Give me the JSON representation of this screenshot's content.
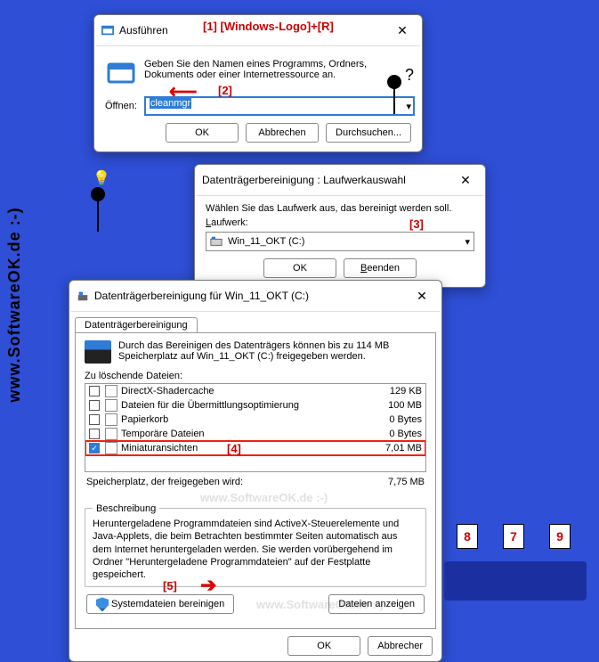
{
  "watermark_vert": "www.SoftwareOK.de :-)",
  "faint_wm": "www.SoftwareOK.de :-)",
  "anno": {
    "a1": "[1] [Windows-Logo]+[R]",
    "a2": "[2]",
    "a3": "[3]",
    "a4": "[4]",
    "a5": "[5]"
  },
  "run": {
    "title": "Ausführen",
    "desc": "Geben Sie den Namen eines Programms, Ordners, Dokuments oder einer Internetressource an.",
    "open_label": "Öffnen:",
    "open_value": "cleanmgr",
    "ok": "OK",
    "cancel": "Abbrechen",
    "browse": "Durchsuchen..."
  },
  "drive": {
    "title": "Datenträgerbereinigung : Laufwerkauswahl",
    "desc": "Wählen Sie das Laufwerk aus, das bereinigt werden soll.",
    "lbl": "Laufwerk:",
    "value": "Win_11_OKT (C:)",
    "ok": "OK",
    "exit": "Beenden"
  },
  "cleanup": {
    "title": "Datenträgerbereinigung für Win_11_OKT (C:)",
    "tab": "Datenträgerbereinigung",
    "summary": "Durch das Bereinigen des Datenträgers können bis zu 114 MB Speicherplatz auf Win_11_OKT (C:) freigegeben werden.",
    "list_label": "Zu löschende Dateien:",
    "rows": [
      {
        "name": "DirectX-Shadercache",
        "size": "129 KB",
        "checked": false
      },
      {
        "name": "Dateien für die Übermittlungsoptimierung",
        "size": "100 MB",
        "checked": false
      },
      {
        "name": "Papierkorb",
        "size": "0 Bytes",
        "checked": false
      },
      {
        "name": "Temporäre Dateien",
        "size": "0 Bytes",
        "checked": false
      },
      {
        "name": "Miniaturansichten",
        "size": "7,01 MB",
        "checked": true
      }
    ],
    "total_label": "Speicherplatz, der freigegeben wird:",
    "total_value": "7,75 MB",
    "desc_title": "Beschreibung",
    "desc_body": "Heruntergeladene Programmdateien sind ActiveX-Steuerelemente und Java-Applets, die beim Betrachten bestimmter Seiten automatisch aus dem Internet heruntergeladen werden. Sie werden vorübergehend im Ordner \"Heruntergeladene Programmdateien\" auf der Festplatte gespeichert.",
    "sys_btn": "Systemdateien bereinigen",
    "view_btn": "Dateien anzeigen",
    "ok": "OK",
    "cancel": "Abbrecher"
  },
  "judges": {
    "c1": "8",
    "c2": "7",
    "c3": "9"
  }
}
